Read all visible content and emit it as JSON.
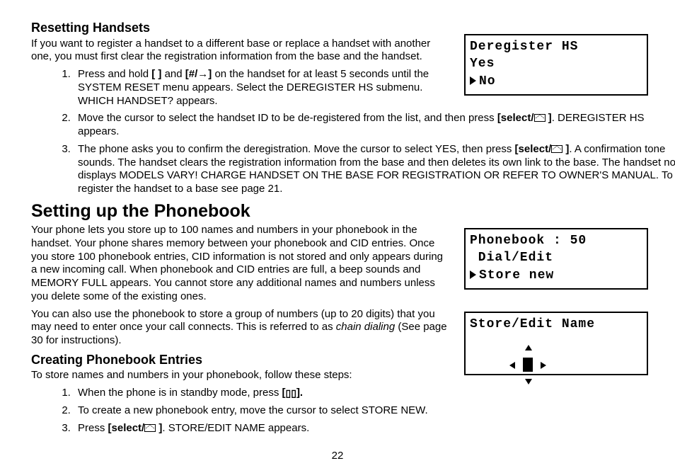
{
  "section1": {
    "title": "Resetting Handsets",
    "intro": "If you want to register a handset to a different base or replace a handset with another one, you must first clear the registration information from the base and the handset.",
    "steps": {
      "s1a": "Press and hold ",
      "s1key1": "[ ]",
      "s1b": " and ",
      "s1key2": "[#/→]",
      "s1c": " on the handset for at least 5 seconds until the SYSTEM RESET menu appears. Select the DEREGISTER HS submenu. WHICH HANDSET? appears.",
      "s2a": "Move the cursor to select the handset ID to be de-registered from the list, and then press ",
      "s2key": "[select/",
      "s2b": ". DEREGISTER HS appears.",
      "s3a": "The phone asks you to confirm the deregistration. Move the cursor to select YES, then press ",
      "s3key": "[select/",
      "s3b": ". A confirmation tone sounds. The handset clears the registration information from the base and then deletes its own link to the base. The handset now displays MODELS VARY! CHARGE HANDSET ON THE BASE FOR REGISTRATION OR REFER TO OWNER'S MANUAL. To register the handset to a base see page 21."
    }
  },
  "section2": {
    "title": "Setting up the Phonebook",
    "p1": "Your phone lets you store up to 100 names and numbers in your phonebook in the handset. Your phone shares memory between your phonebook and CID entries. Once you store 100 phonebook entries, CID information is not stored and only appears during a new incoming call. When phonebook and CID entries are full, a beep sounds and MEMORY FULL appears. You cannot store any additional names and numbers unless you delete some of the existing ones.",
    "p2a": "You can also use the phonebook to store a group of numbers (up to 20 digits) that you may need to enter once your call connects. This is referred to as ",
    "p2italic": "chain dialing",
    "p2b": " (See page 30 for instructions)."
  },
  "section3": {
    "title": "Creating Phonebook Entries",
    "intro": "To store names and numbers in your phonebook, follow these steps:",
    "steps": {
      "s1a": "When the phone is in standby mode, press ",
      "s1keyL": "[",
      "s1keyR": "].",
      "s2": "To create a new phonebook entry, move the cursor to select STORE NEW.",
      "s3a": "Press ",
      "s3key": "[select/",
      "s3b": ". STORE/EDIT NAME appears."
    }
  },
  "lcd1": {
    "l1": "Deregister HS",
    "l2": "Yes",
    "l3": "No"
  },
  "lcd2": {
    "l1": "Phonebook : 50",
    "l2": " Dial/Edit",
    "l3": "Store new"
  },
  "lcd3": {
    "l1": "Store/Edit Name"
  },
  "pagenum": "22"
}
